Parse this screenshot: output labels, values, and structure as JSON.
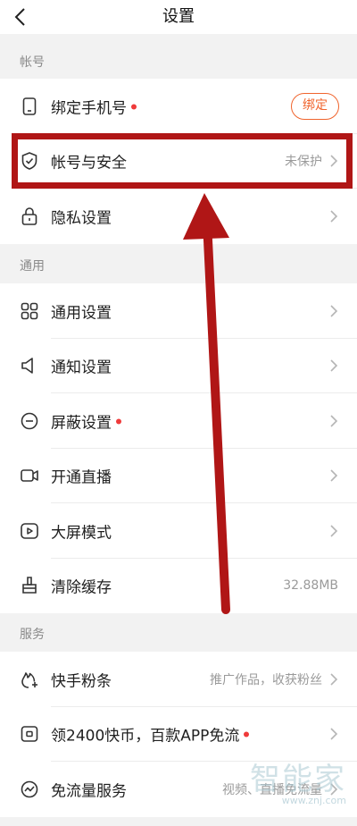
{
  "header": {
    "title": "设置"
  },
  "sections": {
    "account": {
      "label": "帐号",
      "items": [
        {
          "label": "绑定手机号",
          "dot": true,
          "button": "绑定"
        },
        {
          "label": "帐号与安全",
          "value": "未保护"
        },
        {
          "label": "隐私设置"
        }
      ]
    },
    "general": {
      "label": "通用",
      "items": [
        {
          "label": "通用设置"
        },
        {
          "label": "通知设置"
        },
        {
          "label": "屏蔽设置",
          "dot": true
        },
        {
          "label": "开通直播"
        },
        {
          "label": "大屏模式"
        },
        {
          "label": "清除缓存",
          "value": "32.88MB"
        }
      ]
    },
    "services": {
      "label": "服务",
      "items": [
        {
          "label": "快手粉条",
          "value": "推广作品，收获粉丝"
        },
        {
          "label": "领2400快币，百款APP免流",
          "dot": true
        },
        {
          "label": "免流量服务",
          "value": "视频、直播免流量"
        }
      ]
    }
  },
  "watermark": {
    "text": "智能家",
    "url": "www.znj.com"
  },
  "colors": {
    "accent": "#f0642d",
    "dot": "#ef3b3b",
    "annotation": "#b01616"
  }
}
